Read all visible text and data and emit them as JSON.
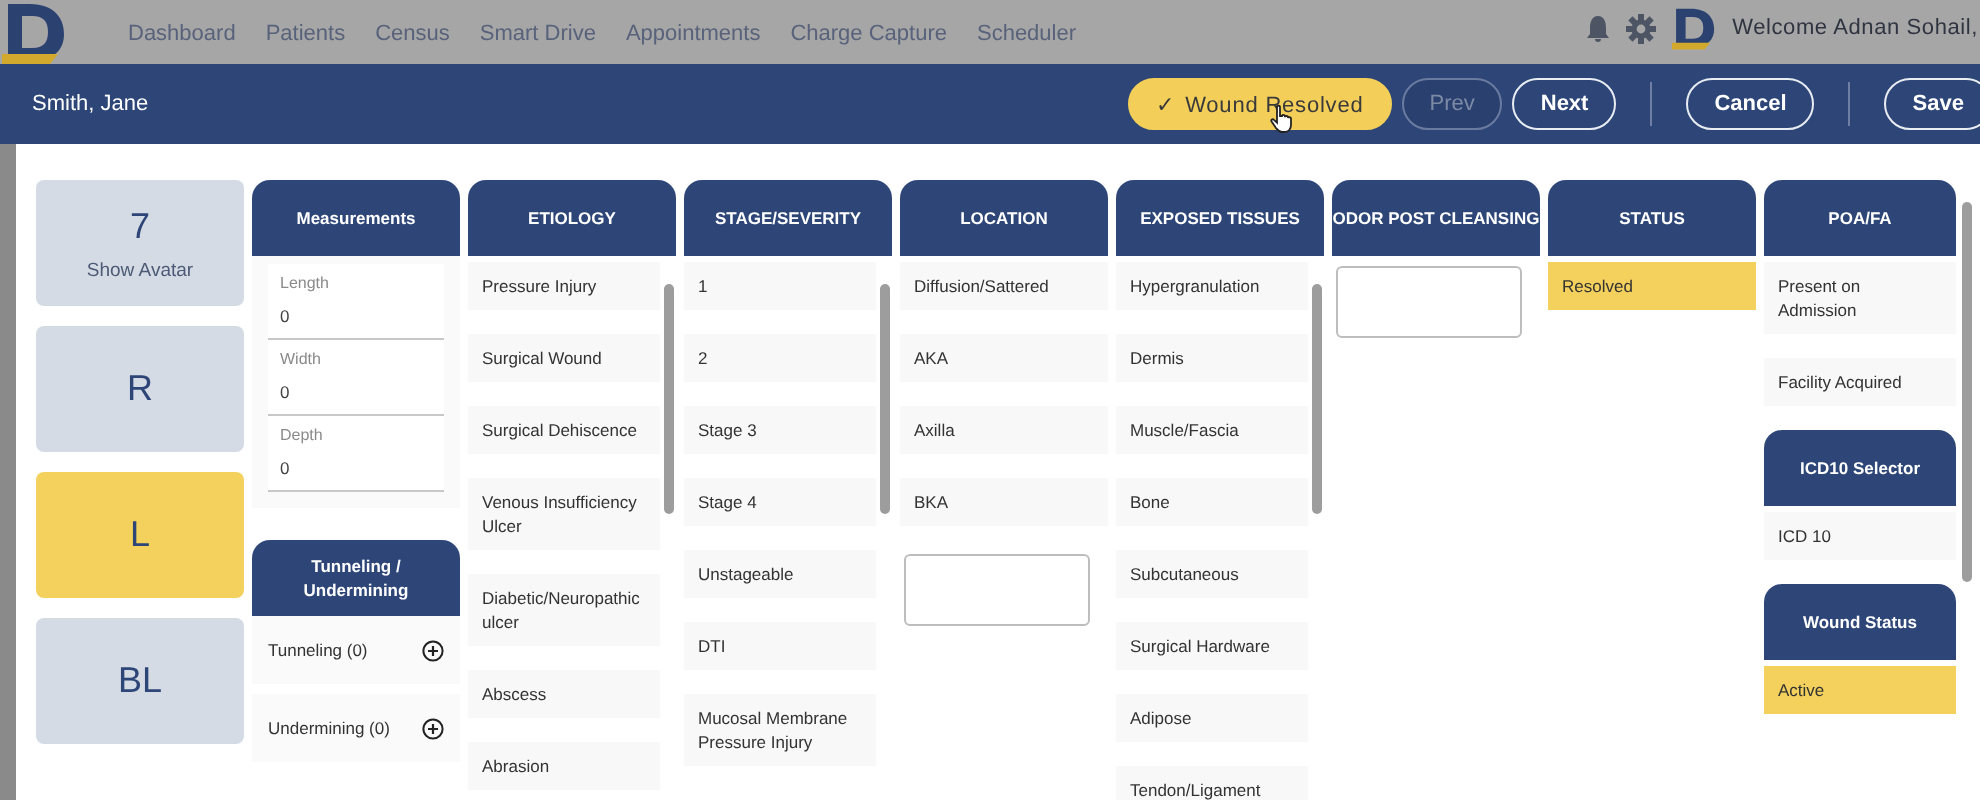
{
  "nav": {
    "items": [
      {
        "label": "Dashboard"
      },
      {
        "label": "Patients"
      },
      {
        "label": "Census"
      },
      {
        "label": "Smart Drive"
      },
      {
        "label": "Appointments"
      },
      {
        "label": "Charge Capture"
      },
      {
        "label": "Scheduler"
      }
    ],
    "user": "Welcome Adnan Sohail,"
  },
  "header": {
    "patient": "Smith, Jane",
    "buttons": [
      {
        "kind": "toggle",
        "icon": "✓",
        "label": "Wound Resolved",
        "checked": true
      },
      {
        "kind": "plain",
        "label": "Prev",
        "disabled": true
      },
      {
        "kind": "plain",
        "label": "Next",
        "disabled": false
      },
      {
        "kind": "separator"
      },
      {
        "kind": "plain",
        "label": "Cancel",
        "disabled": false
      },
      {
        "kind": "separator"
      },
      {
        "kind": "plain",
        "label": "Save",
        "disabled": false
      }
    ]
  },
  "tiles": [
    {
      "label": "7",
      "caption": "Show Avatar",
      "selected": false
    },
    {
      "label": "R",
      "selected": false
    },
    {
      "label": "L",
      "selected": true
    },
    {
      "label": "BL",
      "selected": false
    }
  ],
  "measurements": {
    "title": "Measurements",
    "fields": [
      {
        "label": "Length",
        "value": "0"
      },
      {
        "label": "Width",
        "value": "0"
      },
      {
        "label": "Depth",
        "value": "0"
      }
    ]
  },
  "tunneling": {
    "title": "Tunneling / Undermining",
    "items": [
      {
        "label": "Tunneling (0)"
      },
      {
        "label": "Undermining (0)"
      }
    ]
  },
  "columns": [
    {
      "kind": "scrolling",
      "panels": [
        {
          "title": "ETIOLOGY",
          "options": [
            {
              "kind": "option",
              "label": "Pressure Injury",
              "selected": false
            },
            {
              "kind": "option",
              "label": "Surgical Wound",
              "selected": false
            },
            {
              "kind": "option",
              "label": "Surgical Dehiscence",
              "selected": false
            },
            {
              "kind": "option",
              "label": "Venous Insufficiency Ulcer",
              "selected": false
            },
            {
              "kind": "option",
              "label": "Diabetic/Neuropathic ulcer",
              "selected": false
            },
            {
              "kind": "option",
              "label": "Abscess",
              "selected": false
            },
            {
              "kind": "option",
              "label": "Abrasion",
              "selected": false
            }
          ]
        }
      ]
    },
    {
      "kind": "scrolling",
      "panels": [
        {
          "title": "STAGE/SEVERITY",
          "options": [
            {
              "kind": "option",
              "label": "1",
              "selected": false
            },
            {
              "kind": "option",
              "label": "2",
              "selected": false
            },
            {
              "kind": "option",
              "label": "Stage 3",
              "selected": false
            },
            {
              "kind": "option",
              "label": "Stage 4",
              "selected": false
            },
            {
              "kind": "option",
              "label": "Unstageable",
              "selected": false
            },
            {
              "kind": "option",
              "label": "DTI",
              "selected": false
            },
            {
              "kind": "option",
              "label": "Mucosal Membrane Pressure Injury",
              "selected": false
            }
          ]
        }
      ]
    },
    {
      "kind": "plain",
      "panels": [
        {
          "title": "LOCATION",
          "options": [
            {
              "kind": "option",
              "label": "Diffusion/Sattered",
              "selected": false
            },
            {
              "kind": "option",
              "label": "AKA",
              "selected": false
            },
            {
              "kind": "option",
              "label": "Axilla",
              "selected": false
            },
            {
              "kind": "option",
              "label": "BKA",
              "selected": false
            },
            {
              "kind": "textbox"
            }
          ]
        }
      ]
    },
    {
      "kind": "scrolling",
      "panels": [
        {
          "title": "EXPOSED TISSUES",
          "options": [
            {
              "kind": "option",
              "label": "Hypergranulation",
              "selected": false
            },
            {
              "kind": "option",
              "label": "Dermis",
              "selected": false
            },
            {
              "kind": "option",
              "label": "Muscle/Fascia",
              "selected": false
            },
            {
              "kind": "option",
              "label": "Bone",
              "selected": false
            },
            {
              "kind": "option",
              "label": "Subcutaneous",
              "selected": false
            },
            {
              "kind": "option",
              "label": "Surgical Hardware",
              "selected": false
            },
            {
              "kind": "option",
              "label": "Adipose",
              "selected": false
            },
            {
              "kind": "option",
              "label": "Tendon/Ligament",
              "selected": false
            }
          ]
        }
      ]
    },
    {
      "kind": "plain",
      "panels": [
        {
          "title": "ODOR POST CLEANSING",
          "options": [
            {
              "kind": "textbox"
            }
          ]
        }
      ]
    },
    {
      "kind": "plain",
      "panels": [
        {
          "title": "STATUS",
          "options": [
            {
              "kind": "option",
              "label": "Resolved",
              "selected": true
            }
          ]
        }
      ]
    },
    {
      "kind": "stack",
      "panels": [
        {
          "title": "POA/FA",
          "options": [
            {
              "kind": "option",
              "label": "Present on Admission",
              "selected": false
            },
            {
              "kind": "option",
              "label": "Facility Acquired",
              "selected": false
            }
          ]
        },
        {
          "title": "ICD10 Selector",
          "options": [
            {
              "kind": "option",
              "label": "ICD 10",
              "selected": false
            }
          ]
        },
        {
          "title": "Wound Status",
          "options": [
            {
              "kind": "option",
              "label": "Active",
              "selected": true
            }
          ]
        }
      ]
    }
  ]
}
